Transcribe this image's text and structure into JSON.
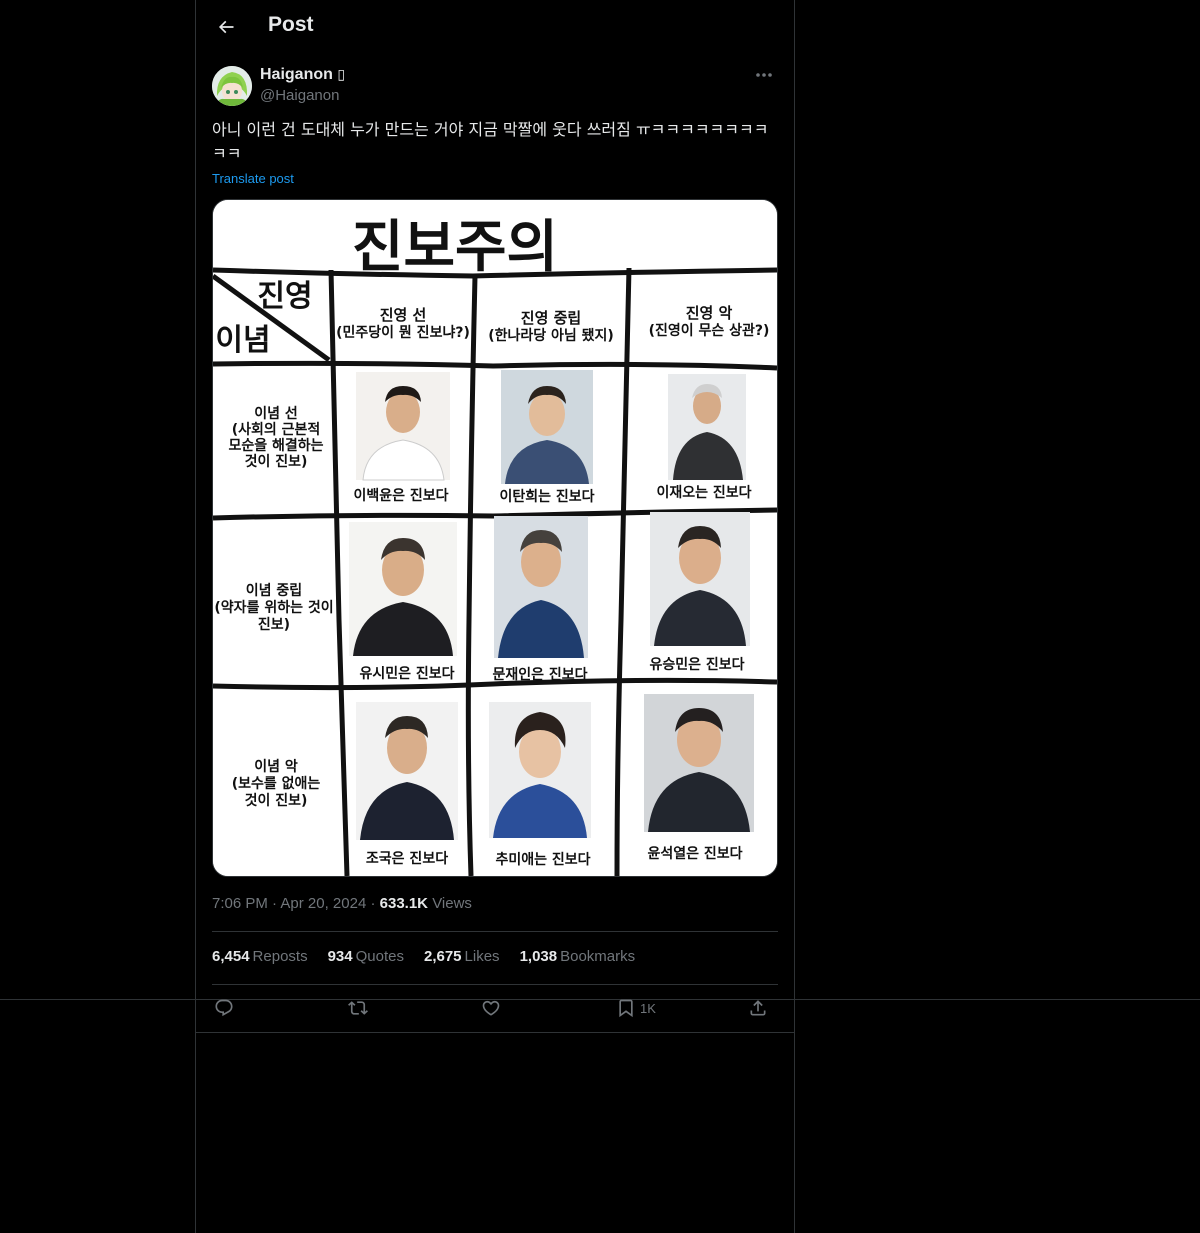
{
  "header": {
    "title": "Post"
  },
  "author": {
    "name": "Haiganon",
    "name_suffix": "▯",
    "handle": "@Haiganon"
  },
  "post": {
    "text": "아니 이런 건 도대체 누가 만드는 거야 지금 막짤에 웃다 쓰러짐 ㅠㅋㅋㅋㅋㅋㅋㅋㅋㅋㅋ",
    "translate_label": "Translate post"
  },
  "image": {
    "title": "진보주의",
    "corner_top": "진영",
    "corner_bottom": "이념",
    "columns": [
      {
        "line1": "진영 선",
        "line2": "(민주당이 뭔 진보냐?)"
      },
      {
        "line1": "진영 중립",
        "line2": "(한나라당 아님 됐지)"
      },
      {
        "line1": "진영 악",
        "line2": "(진영이 무슨 상관?)"
      }
    ],
    "rows": [
      {
        "lines": [
          "이념 선",
          "(사회의 근본적",
          "모순을 해결하는",
          "것이 진보)"
        ]
      },
      {
        "lines": [
          "이념 중립",
          "(약자를 위하는 것이",
          "진보)"
        ]
      },
      {
        "lines": [
          "이념 악",
          "(보수를 없애는",
          "것이 진보)"
        ]
      }
    ],
    "captions": [
      [
        "이백윤은 진보다",
        "이탄희는 진보다",
        "이재오는 진보다"
      ],
      [
        "유시민은 진보다",
        "문재인은 진보다",
        "유승민은 진보다"
      ],
      [
        "조국은 진보다",
        "추미애는 진보다",
        "윤석열은 진보다"
      ]
    ]
  },
  "meta": {
    "time": "7:06 PM",
    "date": "Apr 20, 2024",
    "views_count": "633.1K",
    "views_label": "Views"
  },
  "stats": {
    "reposts_count": "6,454",
    "reposts_label": "Reposts",
    "quotes_count": "934",
    "quotes_label": "Quotes",
    "likes_count": "2,675",
    "likes_label": "Likes",
    "bookmarks_count": "1,038",
    "bookmarks_label": "Bookmarks"
  },
  "actions": {
    "bookmark_count": "1K"
  },
  "icons": {
    "back": "arrow-left-icon",
    "more": "more-icon",
    "reply": "reply-icon",
    "repost": "repost-icon",
    "like": "heart-icon",
    "bookmark": "bookmark-icon",
    "share": "share-icon"
  },
  "colors": {
    "background": "#000000",
    "text": "#e7e9ea",
    "secondary": "#71767b",
    "link": "#1d9bf0",
    "border": "#2f3336"
  }
}
